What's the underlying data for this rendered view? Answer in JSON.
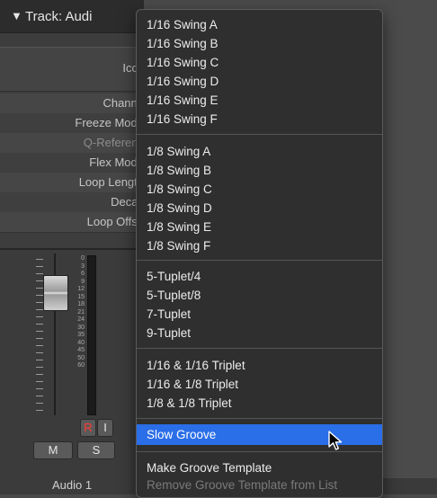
{
  "inspector": {
    "track_title": "Track:  Audi",
    "disclosure_glyph": "▼",
    "icon_label": "Icor",
    "params": [
      {
        "label": "Channe",
        "dim": false
      },
      {
        "label": "Freeze Mode",
        "dim": false
      },
      {
        "label": "Q-Referenc",
        "dim": true
      },
      {
        "label": "Flex Mode",
        "dim": false
      },
      {
        "label": "Loop Length",
        "dim": false
      },
      {
        "label": "Decay",
        "dim": false
      },
      {
        "label": "Loop Offse",
        "dim": false
      }
    ],
    "meter_scale": [
      "0",
      "3",
      "6",
      "9",
      "12",
      "15",
      "18",
      "21",
      "24",
      "30",
      "35",
      "40",
      "45",
      "50",
      "60"
    ],
    "buttons": {
      "record": "R",
      "input": "I",
      "mute": "M",
      "solo": "S"
    },
    "track_name": "Audio 1"
  },
  "menu": {
    "groups": [
      [
        "1/16 Swing A",
        "1/16 Swing B",
        "1/16 Swing C",
        "1/16 Swing D",
        "1/16 Swing E",
        "1/16 Swing F"
      ],
      [
        "1/8 Swing A",
        "1/8 Swing B",
        "1/8 Swing C",
        "1/8 Swing D",
        "1/8 Swing E",
        "1/8 Swing F"
      ],
      [
        "5-Tuplet/4",
        "5-Tuplet/8",
        "7-Tuplet",
        "9-Tuplet"
      ],
      [
        "1/16 & 1/16 Triplet",
        "1/16 & 1/8 Triplet",
        "1/8 & 1/8 Triplet"
      ],
      [
        "Slow Groove"
      ],
      [
        "Make Groove Template",
        "Remove Groove Template from List"
      ]
    ],
    "selected_item": "Slow Groove",
    "disabled_item": "Remove Groove Template from List",
    "accent_color": "#2a6ee8"
  }
}
